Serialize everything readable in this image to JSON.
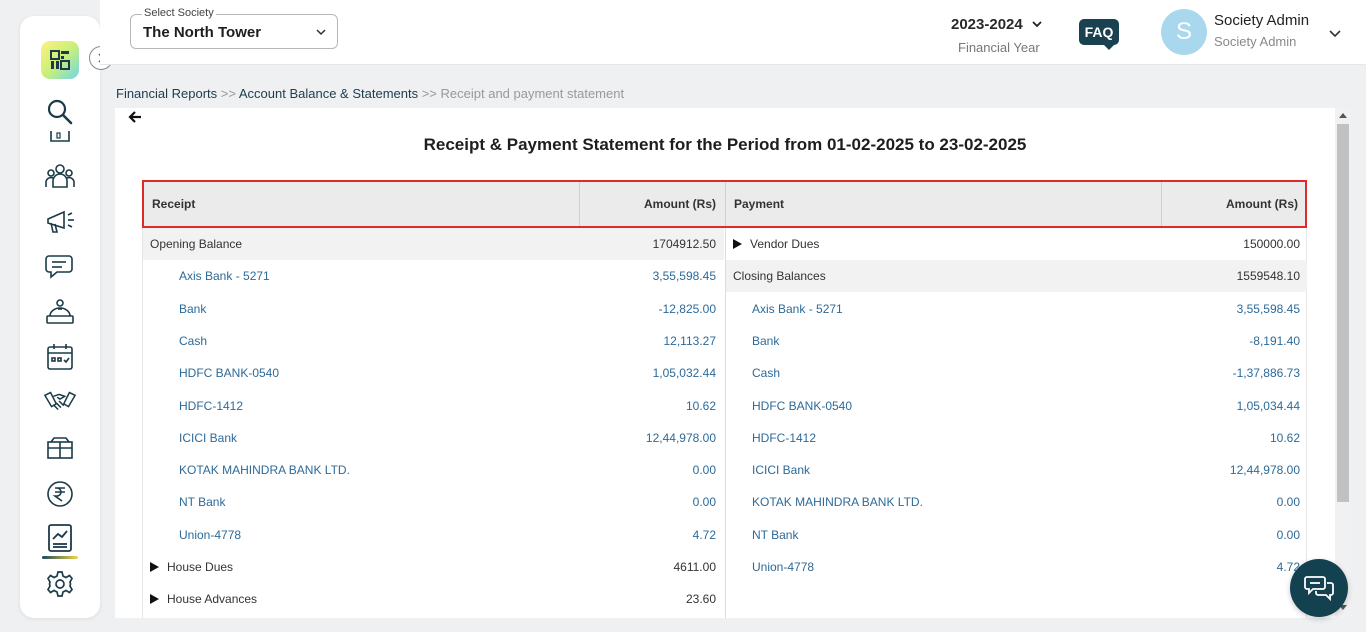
{
  "sidebar": {
    "logo": "app-logo",
    "icons": [
      "search-icon",
      "building-icon",
      "residents-icon",
      "announcement-icon",
      "chat-icon",
      "helpdesk-icon",
      "calendar-icon",
      "handshake-icon",
      "parcel-icon",
      "rupee-icon",
      "reports-icon",
      "settings-icon"
    ]
  },
  "header": {
    "society_label": "Select Society",
    "society_value": "The North Tower",
    "financial_year": "2023-2024",
    "financial_year_label": "Financial Year",
    "faq_label": "FAQ",
    "avatar_letter": "S",
    "user_name": "Society Admin",
    "user_role": "Society Admin"
  },
  "breadcrumb": {
    "items": [
      "Financial Reports",
      "Account Balance & Statements",
      "Receipt and payment statement"
    ],
    "separator": ">>"
  },
  "report": {
    "title": "Receipt & Payment Statement for the Period from 01-02-2025 to 23-02-2025",
    "columns": {
      "receipt": "Receipt",
      "receipt_amount": "Amount (Rs)",
      "payment": "Payment",
      "payment_amount": "Amount (Rs)"
    },
    "receipts": [
      {
        "label": "Opening Balance",
        "amount": "1704912.50",
        "kind": "group"
      },
      {
        "label": "Axis Bank - 5271",
        "amount": "3,55,598.45",
        "kind": "sub"
      },
      {
        "label": "Bank",
        "amount": "-12,825.00",
        "kind": "sub"
      },
      {
        "label": "Cash",
        "amount": "12,113.27",
        "kind": "sub"
      },
      {
        "label": "HDFC BANK-0540",
        "amount": "1,05,032.44",
        "kind": "sub"
      },
      {
        "label": "HDFC-1412",
        "amount": "10.62",
        "kind": "sub"
      },
      {
        "label": "ICICI Bank",
        "amount": "12,44,978.00",
        "kind": "sub"
      },
      {
        "label": "KOTAK MAHINDRA BANK LTD.",
        "amount": "0.00",
        "kind": "sub"
      },
      {
        "label": "NT Bank",
        "amount": "0.00",
        "kind": "sub"
      },
      {
        "label": "Union-4778",
        "amount": "4.72",
        "kind": "sub"
      },
      {
        "label": "House Dues",
        "amount": "4611.00",
        "kind": "expand"
      },
      {
        "label": "House Advances",
        "amount": "23.60",
        "kind": "expand"
      }
    ],
    "payments": [
      {
        "label": "Vendor Dues",
        "amount": "150000.00",
        "kind": "expand"
      },
      {
        "label": "Closing Balances",
        "amount": "1559548.10",
        "kind": "group"
      },
      {
        "label": "Axis Bank - 5271",
        "amount": "3,55,598.45",
        "kind": "sub"
      },
      {
        "label": "Bank",
        "amount": "-8,191.40",
        "kind": "sub"
      },
      {
        "label": "Cash",
        "amount": "-1,37,886.73",
        "kind": "sub"
      },
      {
        "label": "HDFC BANK-0540",
        "amount": "1,05,034.44",
        "kind": "sub"
      },
      {
        "label": "HDFC-1412",
        "amount": "10.62",
        "kind": "sub"
      },
      {
        "label": "ICICI Bank",
        "amount": "12,44,978.00",
        "kind": "sub"
      },
      {
        "label": "KOTAK MAHINDRA BANK LTD.",
        "amount": "0.00",
        "kind": "sub"
      },
      {
        "label": "NT Bank",
        "amount": "0.00",
        "kind": "sub"
      },
      {
        "label": "Union-4778",
        "amount": "4.72",
        "kind": "sub"
      }
    ]
  },
  "colors": {
    "brand_dark": "#14414f",
    "highlight_border": "#e02a2a",
    "link_blue": "#2d6a98"
  }
}
